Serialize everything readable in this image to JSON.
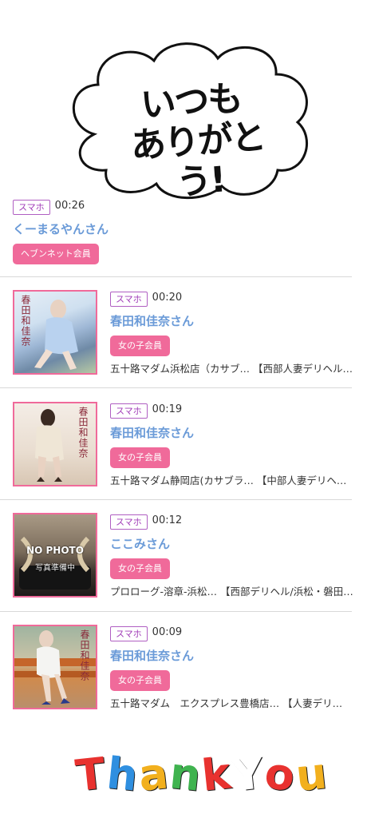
{
  "sticker": {
    "line1": "いつも",
    "line2": "ありがとう!"
  },
  "first_visitor": {
    "device": "スマホ",
    "time": "00:26",
    "name": "くーまるやんさん",
    "member_type": "ヘブンネット会員"
  },
  "visitors": [
    {
      "device": "スマホ",
      "time": "00:20",
      "name": "春田和佳奈さん",
      "member_type": "女の子会員",
      "shop": "五十路マダム浜松店（カサブ… 【西部人妻デリヘル…",
      "thumb_text": "春田和佳奈"
    },
    {
      "device": "スマホ",
      "time": "00:19",
      "name": "春田和佳奈さん",
      "member_type": "女の子会員",
      "shop": "五十路マダム静岡店(カサブラ… 【中部人妻デリヘ…",
      "thumb_text": "春田和佳奈"
    },
    {
      "device": "スマホ",
      "time": "00:12",
      "name": "ここみさん",
      "member_type": "女の子会員",
      "shop": "プロローグ-溶章-浜松… 【西部デリヘル/浜松・磐田…",
      "thumb_text": "",
      "nophoto": "NO PHOTO",
      "nophoto_sub": "写真準備中"
    },
    {
      "device": "スマホ",
      "time": "00:09",
      "name": "春田和佳奈さん",
      "member_type": "女の子会員",
      "shop": "五十路マダム　エクスプレス豊橋店… 【人妻デリ…",
      "thumb_text": "春田和佳奈"
    }
  ],
  "thank_you": "Thank You",
  "colors": {
    "accent_pink": "#f06a9a",
    "name_blue": "#6b9bd8",
    "badge_purple": "#a13db8"
  }
}
